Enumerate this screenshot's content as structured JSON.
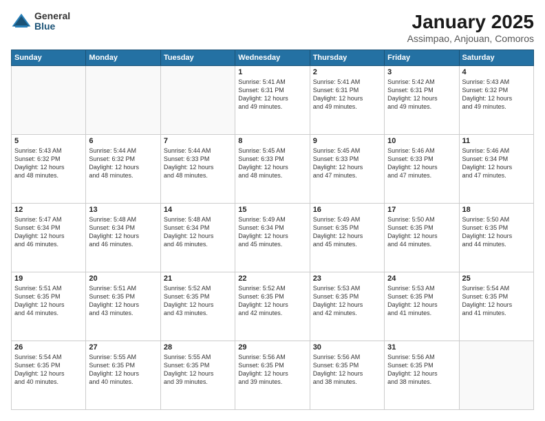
{
  "logo": {
    "general": "General",
    "blue": "Blue"
  },
  "header": {
    "title": "January 2025",
    "subtitle": "Assimpao, Anjouan, Comoros"
  },
  "weekdays": [
    "Sunday",
    "Monday",
    "Tuesday",
    "Wednesday",
    "Thursday",
    "Friday",
    "Saturday"
  ],
  "weeks": [
    [
      {
        "day": "",
        "info": ""
      },
      {
        "day": "",
        "info": ""
      },
      {
        "day": "",
        "info": ""
      },
      {
        "day": "1",
        "info": "Sunrise: 5:41 AM\nSunset: 6:31 PM\nDaylight: 12 hours\nand 49 minutes."
      },
      {
        "day": "2",
        "info": "Sunrise: 5:41 AM\nSunset: 6:31 PM\nDaylight: 12 hours\nand 49 minutes."
      },
      {
        "day": "3",
        "info": "Sunrise: 5:42 AM\nSunset: 6:31 PM\nDaylight: 12 hours\nand 49 minutes."
      },
      {
        "day": "4",
        "info": "Sunrise: 5:43 AM\nSunset: 6:32 PM\nDaylight: 12 hours\nand 49 minutes."
      }
    ],
    [
      {
        "day": "5",
        "info": "Sunrise: 5:43 AM\nSunset: 6:32 PM\nDaylight: 12 hours\nand 48 minutes."
      },
      {
        "day": "6",
        "info": "Sunrise: 5:44 AM\nSunset: 6:32 PM\nDaylight: 12 hours\nand 48 minutes."
      },
      {
        "day": "7",
        "info": "Sunrise: 5:44 AM\nSunset: 6:33 PM\nDaylight: 12 hours\nand 48 minutes."
      },
      {
        "day": "8",
        "info": "Sunrise: 5:45 AM\nSunset: 6:33 PM\nDaylight: 12 hours\nand 48 minutes."
      },
      {
        "day": "9",
        "info": "Sunrise: 5:45 AM\nSunset: 6:33 PM\nDaylight: 12 hours\nand 47 minutes."
      },
      {
        "day": "10",
        "info": "Sunrise: 5:46 AM\nSunset: 6:33 PM\nDaylight: 12 hours\nand 47 minutes."
      },
      {
        "day": "11",
        "info": "Sunrise: 5:46 AM\nSunset: 6:34 PM\nDaylight: 12 hours\nand 47 minutes."
      }
    ],
    [
      {
        "day": "12",
        "info": "Sunrise: 5:47 AM\nSunset: 6:34 PM\nDaylight: 12 hours\nand 46 minutes."
      },
      {
        "day": "13",
        "info": "Sunrise: 5:48 AM\nSunset: 6:34 PM\nDaylight: 12 hours\nand 46 minutes."
      },
      {
        "day": "14",
        "info": "Sunrise: 5:48 AM\nSunset: 6:34 PM\nDaylight: 12 hours\nand 46 minutes."
      },
      {
        "day": "15",
        "info": "Sunrise: 5:49 AM\nSunset: 6:34 PM\nDaylight: 12 hours\nand 45 minutes."
      },
      {
        "day": "16",
        "info": "Sunrise: 5:49 AM\nSunset: 6:35 PM\nDaylight: 12 hours\nand 45 minutes."
      },
      {
        "day": "17",
        "info": "Sunrise: 5:50 AM\nSunset: 6:35 PM\nDaylight: 12 hours\nand 44 minutes."
      },
      {
        "day": "18",
        "info": "Sunrise: 5:50 AM\nSunset: 6:35 PM\nDaylight: 12 hours\nand 44 minutes."
      }
    ],
    [
      {
        "day": "19",
        "info": "Sunrise: 5:51 AM\nSunset: 6:35 PM\nDaylight: 12 hours\nand 44 minutes."
      },
      {
        "day": "20",
        "info": "Sunrise: 5:51 AM\nSunset: 6:35 PM\nDaylight: 12 hours\nand 43 minutes."
      },
      {
        "day": "21",
        "info": "Sunrise: 5:52 AM\nSunset: 6:35 PM\nDaylight: 12 hours\nand 43 minutes."
      },
      {
        "day": "22",
        "info": "Sunrise: 5:52 AM\nSunset: 6:35 PM\nDaylight: 12 hours\nand 42 minutes."
      },
      {
        "day": "23",
        "info": "Sunrise: 5:53 AM\nSunset: 6:35 PM\nDaylight: 12 hours\nand 42 minutes."
      },
      {
        "day": "24",
        "info": "Sunrise: 5:53 AM\nSunset: 6:35 PM\nDaylight: 12 hours\nand 41 minutes."
      },
      {
        "day": "25",
        "info": "Sunrise: 5:54 AM\nSunset: 6:35 PM\nDaylight: 12 hours\nand 41 minutes."
      }
    ],
    [
      {
        "day": "26",
        "info": "Sunrise: 5:54 AM\nSunset: 6:35 PM\nDaylight: 12 hours\nand 40 minutes."
      },
      {
        "day": "27",
        "info": "Sunrise: 5:55 AM\nSunset: 6:35 PM\nDaylight: 12 hours\nand 40 minutes."
      },
      {
        "day": "28",
        "info": "Sunrise: 5:55 AM\nSunset: 6:35 PM\nDaylight: 12 hours\nand 39 minutes."
      },
      {
        "day": "29",
        "info": "Sunrise: 5:56 AM\nSunset: 6:35 PM\nDaylight: 12 hours\nand 39 minutes."
      },
      {
        "day": "30",
        "info": "Sunrise: 5:56 AM\nSunset: 6:35 PM\nDaylight: 12 hours\nand 38 minutes."
      },
      {
        "day": "31",
        "info": "Sunrise: 5:56 AM\nSunset: 6:35 PM\nDaylight: 12 hours\nand 38 minutes."
      },
      {
        "day": "",
        "info": ""
      }
    ]
  ]
}
